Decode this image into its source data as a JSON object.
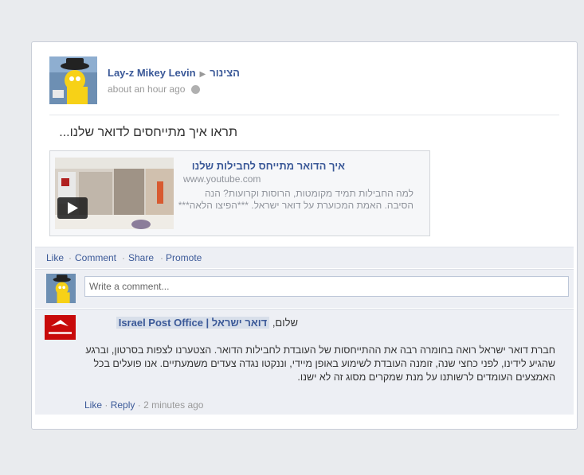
{
  "post": {
    "author": "Lay-z Mikey Levin",
    "target": "הצינור",
    "time": "about an hour ago",
    "message": "תראו איך מתייחסים לדואר שלנו...",
    "link": {
      "title": "איך הדואר מתייחס לחבילות שלנו",
      "url": "www.youtube.com",
      "description": "למה החבילות תמיד מקומטות, הרוסות וקרועות? הנה הסיבה. האמת המכוערת על דואר ישראל. ***הפיצו הלאה***"
    }
  },
  "actions": {
    "like": "Like",
    "comment": "Comment",
    "share": "Share",
    "promote": "Promote"
  },
  "comment_input": {
    "placeholder": "Write a comment..."
  },
  "reply": {
    "author": "דואר ישראל | Israel Post Office",
    "greeting": "שלום,",
    "text": "חברת דואר ישראל רואה בחומרה רבה את ההתייחסות של העובדת לחבילות הדואר. הצטערנו לצפות בסרטון, וברגע שהגיע לידינו, לפני כחצי שנה, זומנה העובדת לשימוע באופן מיידי, וננקטו נגדה צעדים משמעתיים. אנו פועלים בכל האמצעים העומדים לרשותנו על מנת שמקרים מסוג זה לא ישנו.",
    "like": "Like",
    "reply_label": "Reply",
    "time": "2 minutes ago"
  },
  "colors": {
    "link_blue": "#3b5998",
    "muted": "#90949c",
    "background": "#e9ebee"
  }
}
